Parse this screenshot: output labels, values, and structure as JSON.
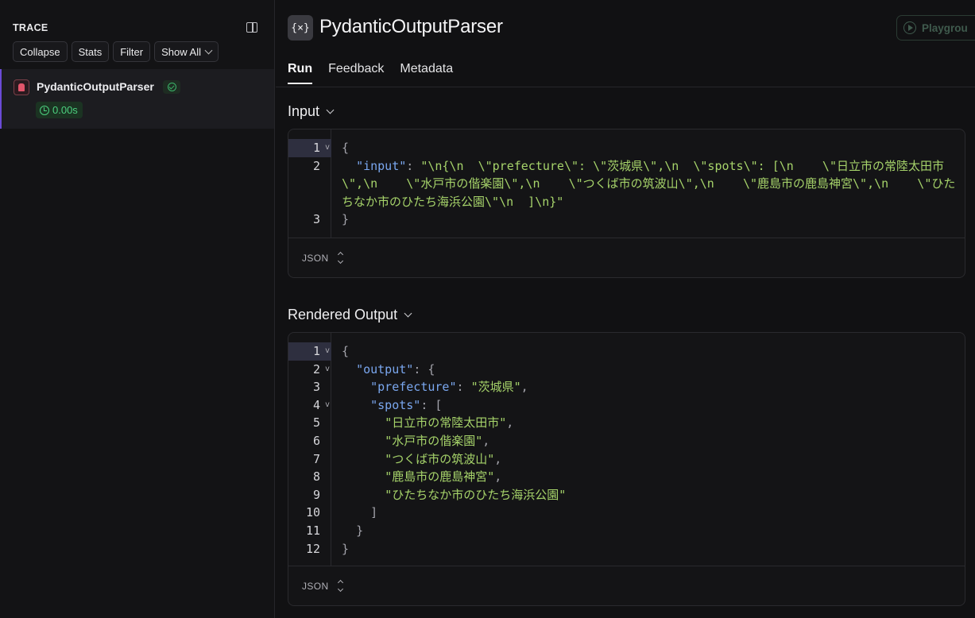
{
  "trace": {
    "header": "TRACE",
    "buttons": {
      "collapse": "Collapse",
      "stats": "Stats",
      "filter": "Filter",
      "show_all": "Show All"
    },
    "item": {
      "name": "PydanticOutputParser",
      "latency": "0.00s"
    }
  },
  "run": {
    "icon_text": "{×}",
    "title": "PydanticOutputParser",
    "playground": "Playgrou",
    "tabs": {
      "run": "Run",
      "feedback": "Feedback",
      "metadata": "Metadata"
    }
  },
  "input_section": {
    "title": "Input",
    "format": "JSON",
    "lines": [
      {
        "n": "1",
        "fold": true,
        "hl": true,
        "parts": [
          {
            "t": "{",
            "c": "p"
          }
        ]
      },
      {
        "n": "2",
        "fold": false,
        "hl": false,
        "parts": [
          {
            "t": "  ",
            "c": "p"
          },
          {
            "t": "\"input\"",
            "c": "k"
          },
          {
            "t": ": ",
            "c": "p"
          },
          {
            "t": "\"\\n{\\n  \\\"prefecture\\\": \\\"茨城県\\\",\\n  \\\"spots\\\": [\\n    \\\"日立市の常陸太田市\\\",\\n    \\\"水戸市の偕楽園\\\",\\n    \\\"つくば市の筑波山\\\",\\n    \\\"鹿島市の鹿島神宮\\\",\\n    \\\"ひたちなか市のひたち海浜公園\\\"\\n  ]\\n}\"",
            "c": "s"
          }
        ]
      },
      {
        "n": "3",
        "fold": false,
        "hl": false,
        "parts": [
          {
            "t": "}",
            "c": "p"
          }
        ]
      }
    ]
  },
  "output_section": {
    "title": "Rendered Output",
    "format": "JSON",
    "lines": [
      {
        "n": "1",
        "fold": true,
        "hl": true,
        "parts": [
          {
            "t": "{",
            "c": "p"
          }
        ]
      },
      {
        "n": "2",
        "fold": true,
        "hl": false,
        "parts": [
          {
            "t": "  ",
            "c": "p"
          },
          {
            "t": "\"output\"",
            "c": "k"
          },
          {
            "t": ": {",
            "c": "p"
          }
        ]
      },
      {
        "n": "3",
        "fold": false,
        "hl": false,
        "parts": [
          {
            "t": "    ",
            "c": "p"
          },
          {
            "t": "\"prefecture\"",
            "c": "k"
          },
          {
            "t": ": ",
            "c": "p"
          },
          {
            "t": "\"茨城県\"",
            "c": "s"
          },
          {
            "t": ",",
            "c": "p"
          }
        ]
      },
      {
        "n": "4",
        "fold": true,
        "hl": false,
        "parts": [
          {
            "t": "    ",
            "c": "p"
          },
          {
            "t": "\"spots\"",
            "c": "k"
          },
          {
            "t": ": [",
            "c": "p"
          }
        ]
      },
      {
        "n": "5",
        "fold": false,
        "hl": false,
        "parts": [
          {
            "t": "      ",
            "c": "p"
          },
          {
            "t": "\"日立市の常陸太田市\"",
            "c": "s"
          },
          {
            "t": ",",
            "c": "p"
          }
        ]
      },
      {
        "n": "6",
        "fold": false,
        "hl": false,
        "parts": [
          {
            "t": "      ",
            "c": "p"
          },
          {
            "t": "\"水戸市の偕楽園\"",
            "c": "s"
          },
          {
            "t": ",",
            "c": "p"
          }
        ]
      },
      {
        "n": "7",
        "fold": false,
        "hl": false,
        "parts": [
          {
            "t": "      ",
            "c": "p"
          },
          {
            "t": "\"つくば市の筑波山\"",
            "c": "s"
          },
          {
            "t": ",",
            "c": "p"
          }
        ]
      },
      {
        "n": "8",
        "fold": false,
        "hl": false,
        "parts": [
          {
            "t": "      ",
            "c": "p"
          },
          {
            "t": "\"鹿島市の鹿島神宮\"",
            "c": "s"
          },
          {
            "t": ",",
            "c": "p"
          }
        ]
      },
      {
        "n": "9",
        "fold": false,
        "hl": false,
        "parts": [
          {
            "t": "      ",
            "c": "p"
          },
          {
            "t": "\"ひたちなか市のひたち海浜公園\"",
            "c": "s"
          }
        ]
      },
      {
        "n": "10",
        "fold": false,
        "hl": false,
        "parts": [
          {
            "t": "    ]",
            "c": "p"
          }
        ]
      },
      {
        "n": "11",
        "fold": false,
        "hl": false,
        "parts": [
          {
            "t": "  }",
            "c": "p"
          }
        ]
      },
      {
        "n": "12",
        "fold": false,
        "hl": false,
        "parts": [
          {
            "t": "}",
            "c": "p"
          }
        ]
      }
    ]
  }
}
